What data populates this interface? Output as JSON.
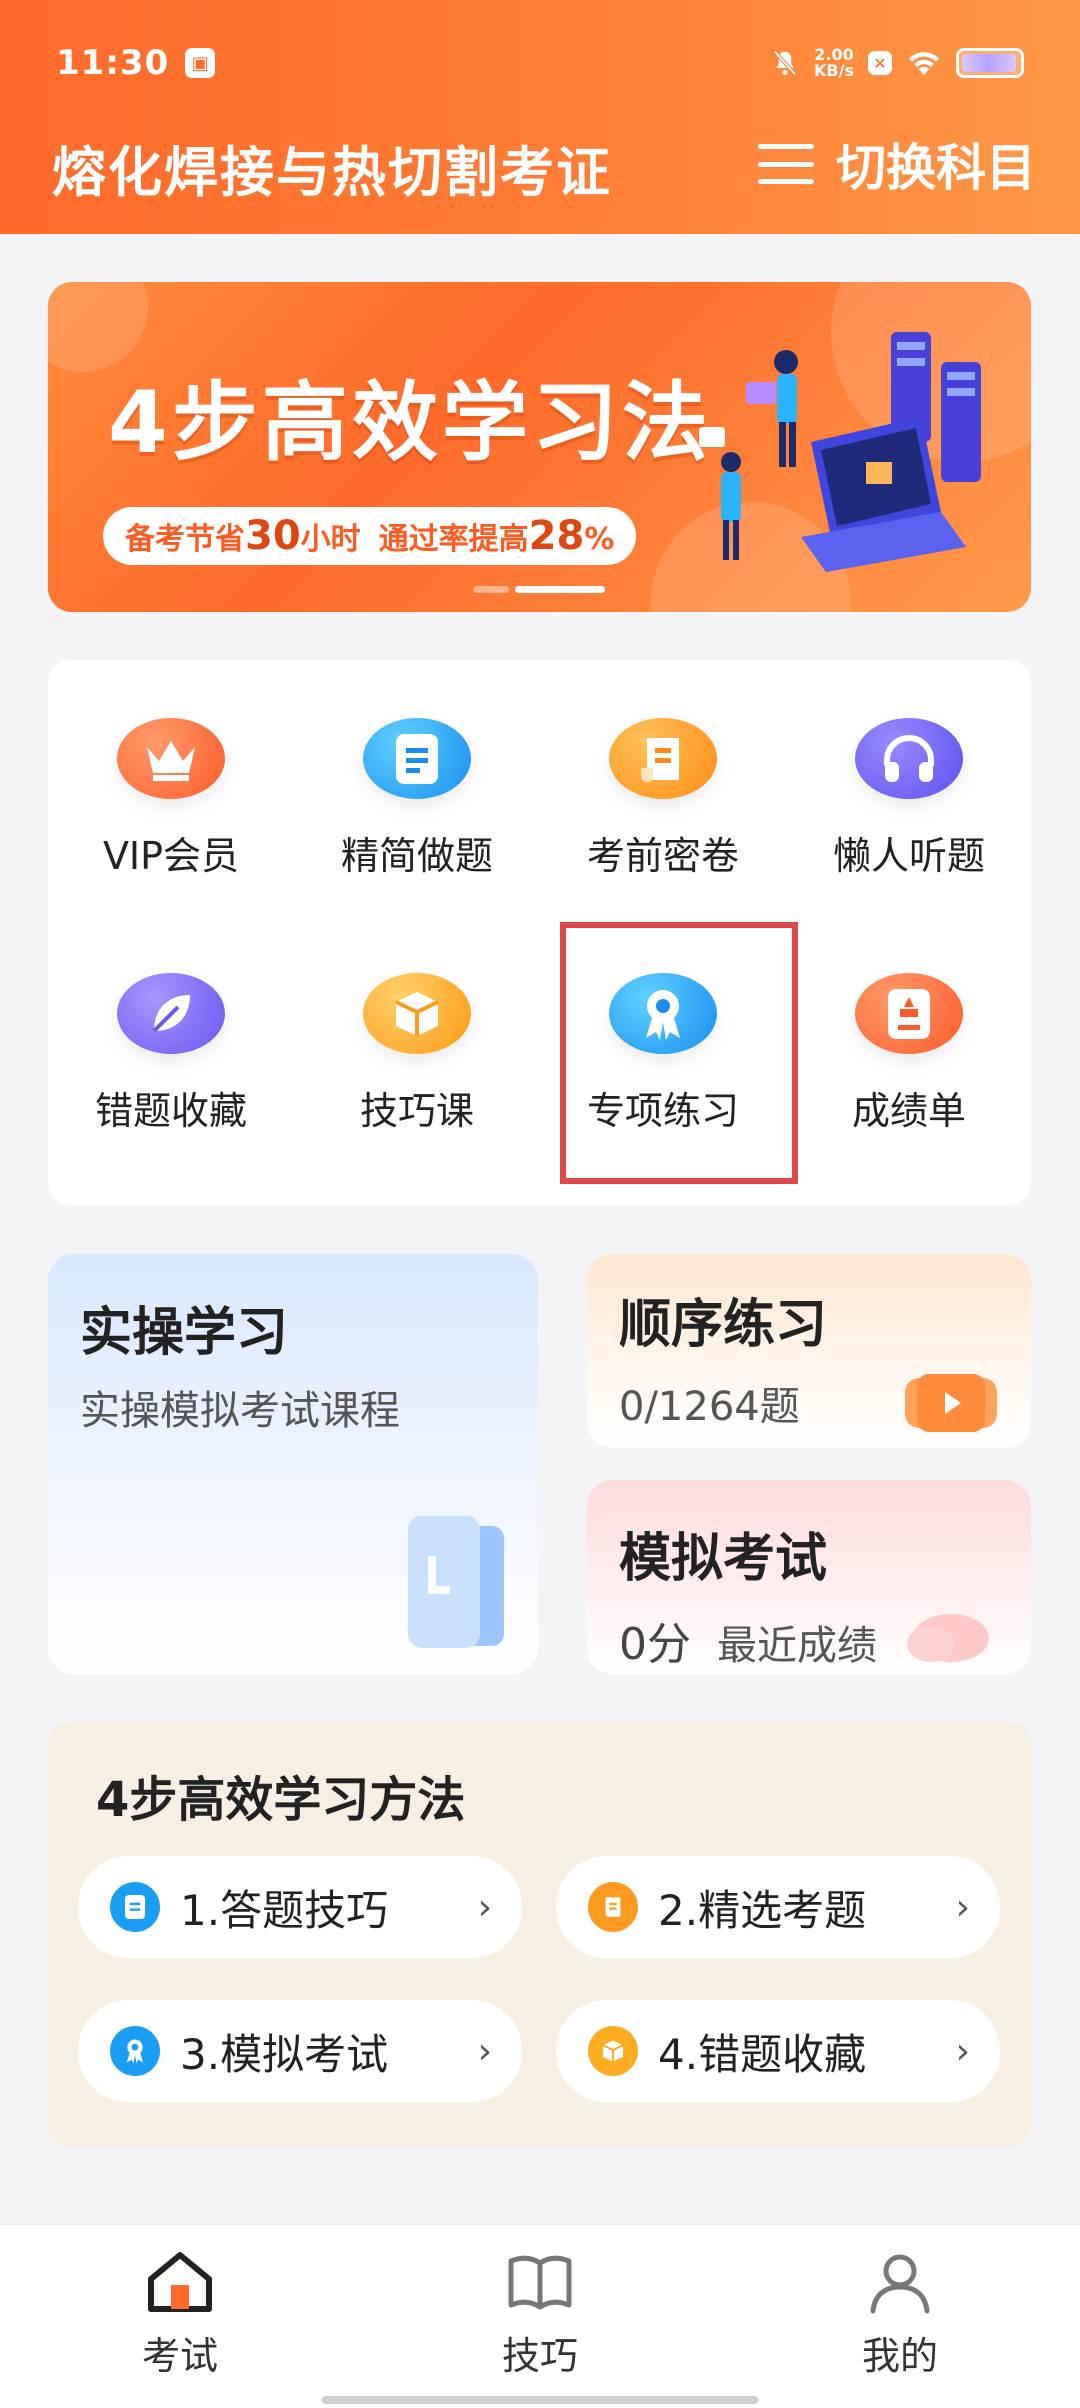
{
  "status_bar": {
    "time": "11:30",
    "speed_value": "2.00",
    "speed_unit": "KB/s"
  },
  "header": {
    "title": "熔化焊接与热切割考证",
    "switch_label": "切换科目"
  },
  "banner": {
    "title": "4步高效学习法",
    "pill_part1": "备考节省",
    "pill_hours": "30",
    "pill_unit1": "小时",
    "pill_part2": "通过率提高",
    "pill_percent": "28",
    "pill_unit2": "%"
  },
  "grid": [
    {
      "label": "VIP会员",
      "icon": "crown-icon",
      "color": "#ff6a3d"
    },
    {
      "label": "精简做题",
      "icon": "document-icon",
      "color": "#1aa3f5"
    },
    {
      "label": "考前密卷",
      "icon": "scroll-icon",
      "color": "#ff9a1f"
    },
    {
      "label": "懒人听题",
      "icon": "headphones-icon",
      "color": "#6c63f5"
    },
    {
      "label": "错题收藏",
      "icon": "leaf-icon",
      "color": "#7a6af7"
    },
    {
      "label": "技巧课",
      "icon": "box-icon",
      "color": "#ffab1f"
    },
    {
      "label": "专项练习",
      "icon": "ribbon-badge-icon",
      "color": "#1aa3f5"
    },
    {
      "label": "成绩单",
      "icon": "certificate-icon",
      "color": "#ff6a3d"
    }
  ],
  "practice": {
    "shicao_title": "实操学习",
    "shicao_sub": "实操模拟考试课程",
    "order_title": "顺序练习",
    "order_progress": "0/1264题",
    "mock_title": "模拟考试",
    "mock_score": "0分",
    "mock_recent": "最近成绩"
  },
  "steps": {
    "title": "4步高效学习方法",
    "items": [
      {
        "label": "1.答题技巧",
        "icon": "document-icon",
        "color": "#1aa3f5"
      },
      {
        "label": "2.精选考题",
        "icon": "scroll-icon",
        "color": "#ff9a1f"
      },
      {
        "label": "3.模拟考试",
        "icon": "ribbon-badge-icon",
        "color": "#1aa3f5"
      },
      {
        "label": "4.错题收藏",
        "icon": "box-icon",
        "color": "#ffab1f"
      }
    ]
  },
  "bottom_nav": [
    {
      "label": "考试",
      "icon": "home-icon",
      "active": true
    },
    {
      "label": "技巧",
      "icon": "book-icon",
      "active": false
    },
    {
      "label": "我的",
      "icon": "person-icon",
      "active": false
    }
  ]
}
